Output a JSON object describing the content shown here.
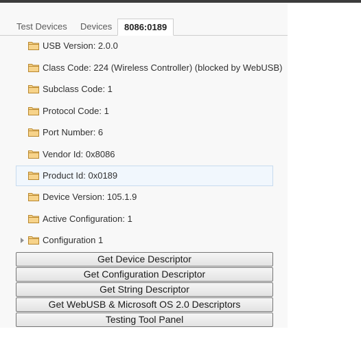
{
  "tabs": [
    {
      "label": "Test Devices"
    },
    {
      "label": "Devices"
    },
    {
      "label": "8086:0189",
      "active": true
    }
  ],
  "tree": {
    "items": [
      {
        "label": "USB Version: 2.0.0"
      },
      {
        "label": "Class Code: 224 (Wireless Controller) (blocked by WebUSB)"
      },
      {
        "label": "Subclass Code: 1"
      },
      {
        "label": "Protocol Code: 1"
      },
      {
        "label": "Port Number: 6"
      },
      {
        "label": "Vendor Id: 0x8086"
      },
      {
        "label": "Product Id: 0x0189",
        "selected": true
      },
      {
        "label": "Device Version: 105.1.9"
      },
      {
        "label": "Active Configuration: 1"
      },
      {
        "label": "Configuration 1",
        "expandable": true
      }
    ]
  },
  "buttons": {
    "device_descriptor": "Get Device Descriptor",
    "configuration_descriptor": "Get Configuration Descriptor",
    "string_descriptor": "Get String Descriptor",
    "webusb_descriptors": "Get WebUSB & Microsoft OS 2.0 Descriptors",
    "testing_tool_panel": "Testing Tool Panel"
  },
  "icons": {
    "folder": "folder-icon",
    "expand": "triangle-right-icon"
  },
  "colors": {
    "folder_fill": "#f7d38a",
    "folder_stroke": "#b8872e",
    "selection_bg": "#f1f7fd",
    "selection_border": "#c7dbef"
  }
}
